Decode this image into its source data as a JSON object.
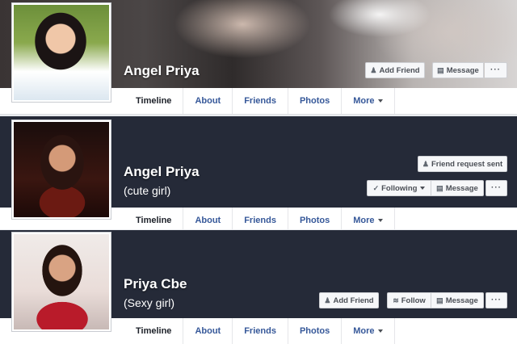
{
  "tabs": [
    "Timeline",
    "About",
    "Friends",
    "Photos",
    "More"
  ],
  "profiles": [
    {
      "name": "Angel Priya",
      "nickname": "",
      "buttons": {
        "add_friend": "Add Friend",
        "message": "Message",
        "more": "···"
      }
    },
    {
      "name": "Angel Priya",
      "nickname": "(cute girl)",
      "buttons": {
        "friend_request_sent": "Friend request sent",
        "following": "Following",
        "message": "Message",
        "more": "···"
      }
    },
    {
      "name": "Priya Cbe",
      "nickname": "(Sexy girl)",
      "buttons": {
        "add_friend": "Add Friend",
        "follow": "Follow",
        "message": "Message",
        "more": "···"
      }
    }
  ],
  "colors": {
    "cover_dark": "#252a38",
    "tab_text": "#4b4f56",
    "link": "#365899"
  }
}
